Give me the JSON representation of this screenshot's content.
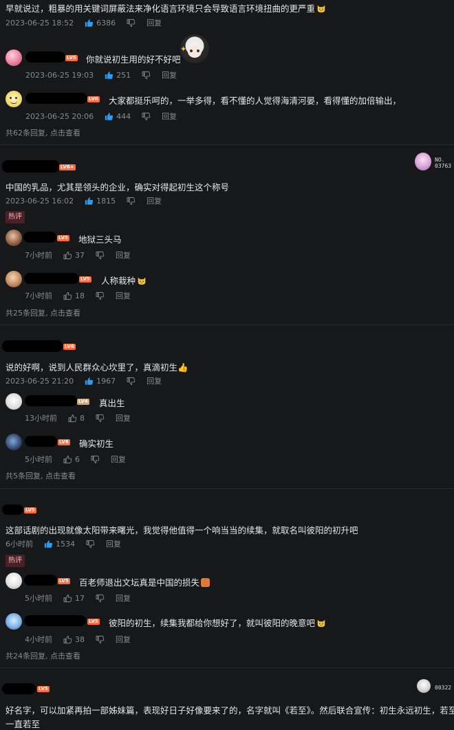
{
  "c0": {
    "text": "早就说过，粗暴的用关键词屏蔽法来净化语言环境只会导致语言环境扭曲的更严重",
    "time": "2023-06-25 18:52",
    "likes": "6386",
    "reply": "回复"
  },
  "c0r1": {
    "level": "LV5",
    "text": "你就说初生用的好不好吧",
    "time": "2023-06-25 19:03",
    "likes": "251",
    "reply": "回复"
  },
  "c0r2": {
    "level": "LV6",
    "text": "大家都挺乐呵的，一举多得，看不懂的人觉得海清河晏，看得懂的加倍输出，",
    "time": "2023-06-25 20:06",
    "likes": "444",
    "reply": "回复"
  },
  "c0more": "共62条回复, 点击查看",
  "c1": {
    "level": "LV6+",
    "text": "中国的乳品，尤其是领头的企业，确实对得起初生这个称号",
    "time": "2023-06-25 16:02",
    "likes": "1815",
    "reply": "回复",
    "badge_no": "NO.",
    "badge_num": "03763"
  },
  "c1hot": "热评",
  "c1r1": {
    "level": "LV5",
    "text": "地狱三头马",
    "time": "7小时前",
    "likes": "37",
    "reply": "回复"
  },
  "c1r2": {
    "level": "LV5",
    "text": "人称栽种",
    "time": "7小时前",
    "likes": "18",
    "reply": "回复"
  },
  "c1more": "共25条回复, 点击查看",
  "c2": {
    "level": "LV6",
    "text": "说的好啊，说到人民群众心坎里了，真滴初生",
    "time": "2023-06-25 21:20",
    "likes": "1967",
    "reply": "回复"
  },
  "c2r1": {
    "level": "LV4",
    "text": "真出生",
    "time": "13小时前",
    "likes": "8",
    "reply": "回复"
  },
  "c2r2": {
    "level": "LV6",
    "text": "确实初生",
    "time": "5小时前",
    "likes": "6",
    "reply": "回复"
  },
  "c2more": "共5条回复, 点击查看",
  "c3": {
    "level": "LV5",
    "text": "这部话剧的出现就像太阳带来曙光，我觉得他值得一个响当当的续集，就取名叫彼阳的初升吧",
    "time": "6小时前",
    "likes": "1534",
    "reply": "回复"
  },
  "c3hot": "热评",
  "c3r1": {
    "level": "LV5",
    "text": "百老师退出文坛真是中国的损失",
    "time": "5小时前",
    "likes": "17",
    "reply": "回复"
  },
  "c3r2": {
    "level": "LV5",
    "text": "彼阳的初生，续集我都给你想好了，就叫彼阳的晚意吧",
    "time": "4小时前",
    "likes": "38",
    "reply": "回复"
  },
  "c3more": "共24条回复, 点击查看",
  "c4": {
    "level": "LV5",
    "text1": "好名字，可以加紧再拍一部姊妹篇，表现好日子好像要来了的，名字就叫《若至》。然后联合宣传：初生永远初生，若至",
    "text2": "一直若至",
    "badge_num": "00322"
  },
  "colors": {
    "bg": "#17181a",
    "accent_like": "#2e9bf0",
    "level": "#ff6a3d",
    "hot_bg": "#4a2027"
  }
}
